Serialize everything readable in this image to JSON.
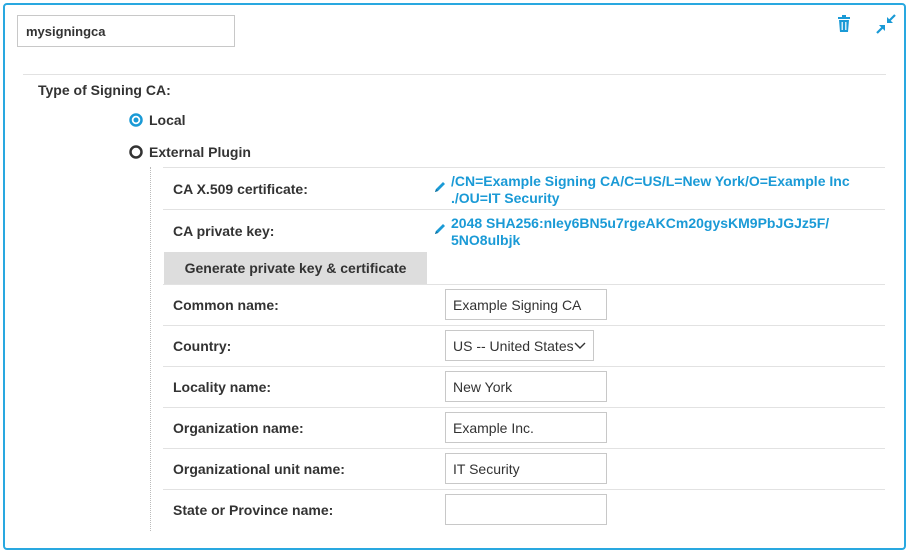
{
  "header": {
    "name_value": "mysigningca",
    "delete_icon": "trash-icon",
    "collapse_icon": "collapse-arrows-icon"
  },
  "type_section": {
    "label": "Type of Signing CA:",
    "options": [
      {
        "label": "Local",
        "selected": true
      },
      {
        "label": "External Plugin",
        "selected": false
      }
    ]
  },
  "certificate": {
    "label": "CA X.509 certificate:",
    "line1": "/CN=Example Signing CA/C=US/L=New York/O=Example Inc",
    "line2": "./OU=IT Security"
  },
  "private_key": {
    "label": "CA private key:",
    "line1": "2048 SHA256:nIey6BN5u7rgeAKCm20gysKM9PbJGJz5F/",
    "line2": "5NO8ulbjk"
  },
  "generate_button": "Generate private key & certificate",
  "fields": {
    "common_name": {
      "label": "Common name:",
      "value": "Example Signing CA"
    },
    "country": {
      "label": "Country:",
      "value": "US -- United States"
    },
    "locality": {
      "label": "Locality name:",
      "value": "New York"
    },
    "organization": {
      "label": "Organization name:",
      "value": "Example Inc."
    },
    "org_unit": {
      "label": "Organizational unit name:",
      "value": "IT Security"
    },
    "state": {
      "label": "State or Province name:",
      "value": ""
    }
  },
  "colors": {
    "accent": "#29a8e0",
    "link": "#1a9ad6",
    "button_bg": "#dddddd"
  }
}
